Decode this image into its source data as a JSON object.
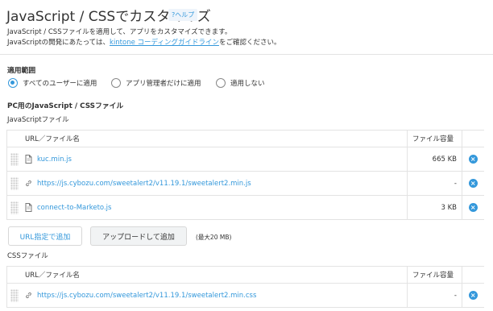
{
  "header": {
    "title": "JavaScript / CSSでカスタマイズ",
    "help": "?ヘルプ",
    "desc1": "JavaScript / CSSファイルを適用して、アプリをカスタマイズできます。",
    "desc2_pre": "JavaScriptの開発にあたっては、",
    "desc2_link": "kintone コーディングガイドライン",
    "desc2_post": "をご確認ください。"
  },
  "scope": {
    "heading": "適用範囲",
    "options": [
      {
        "label": "すべてのユーザーに適用",
        "selected": true
      },
      {
        "label": "アプリ管理者だけに適用",
        "selected": false
      },
      {
        "label": "適用しない",
        "selected": false
      }
    ]
  },
  "pc": {
    "heading": "PC用のJavaScript / CSSファイル",
    "js_label": "JavaScriptファイル",
    "css_label": "CSSファイル",
    "col_name": "URL／ファイル名",
    "col_size": "ファイル容量",
    "js_files": [
      {
        "type": "file",
        "name": "kuc.min.js",
        "size": "665 KB"
      },
      {
        "type": "link",
        "name": "https://js.cybozu.com/sweetalert2/v11.19.1/sweetalert2.min.js",
        "size": "-"
      },
      {
        "type": "file",
        "name": "connect-to-Marketo.js",
        "size": "3 KB"
      }
    ],
    "css_files": [
      {
        "type": "link",
        "name": "https://js.cybozu.com/sweetalert2/v11.19.1/sweetalert2.min.css",
        "size": "-"
      }
    ],
    "btn_url": "URL指定で追加",
    "btn_upload": "アップロードして追加",
    "max_note": "(最大20 MB)"
  },
  "colors": {
    "accent": "#3498db",
    "border": "#e3e3e3",
    "text": "#333333"
  }
}
